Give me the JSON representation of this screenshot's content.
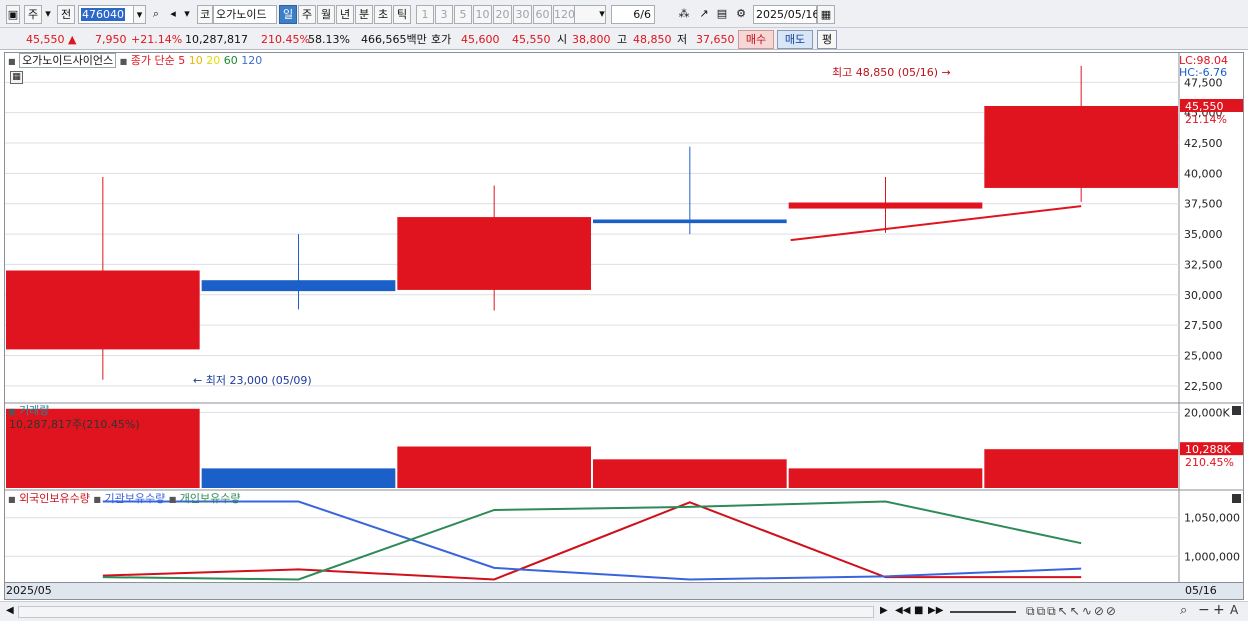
{
  "toolbar": {
    "period_label": "주",
    "prev_label": "전",
    "stock_code": "476040",
    "code_prefix": "코",
    "stock_name": "오가노이드",
    "tabs": [
      "일",
      "주",
      "월",
      "년",
      "분",
      "초",
      "틱"
    ],
    "active_tab": "일",
    "intervals": [
      "1",
      "3",
      "5",
      "10",
      "20",
      "30",
      "60",
      "120"
    ],
    "page_indicator": "6/6",
    "date": "2025/05/16"
  },
  "quote": {
    "price": "45,550",
    "change": "7,950",
    "change_pct": "+21.14%",
    "volume": "10,287,817",
    "volume_ratio": "210.45%",
    "turnover_pct": "58.13%",
    "trade_value": "466,565백만",
    "ask_label": "호가",
    "ask_price": "45,600",
    "bid_price": "45,550",
    "open_label": "시",
    "open": "38,800",
    "high_label": "고",
    "high": "48,850",
    "low_label": "저",
    "low": "37,650",
    "buy_label": "매수",
    "sell_label": "매도",
    "eval_label": "평"
  },
  "price_legend": {
    "name": "오가노이드사이언스",
    "ma_label": "종가 단순",
    "ma_periods": [
      "5",
      "10",
      "20",
      "60",
      "120"
    ],
    "ma_colors": [
      "#e0141e",
      "#f0b400",
      "#e8d800",
      "#1c8a2e",
      "#3c6ed0"
    ]
  },
  "volume_legend": {
    "title": "거래량",
    "value_text": "10,287,817주(210.45%)"
  },
  "holding_legend": [
    "외국인보유수량",
    "기관보유수량",
    "개인보유수량"
  ],
  "right_labels": {
    "lc": "LC:98.04",
    "hc": "HC:-6.76",
    "price_marker": "45,550",
    "price_pct": "21.14%",
    "vol_marker": "10,288K",
    "vol_pct": "210.45%"
  },
  "annotations": {
    "high": "최고 48,850 (05/16)",
    "low": "최저 23,000 (05/09)"
  },
  "date_bar": {
    "left": "2025/05",
    "right": "05/16"
  },
  "colors": {
    "up": "#e0141e",
    "down": "#1b5fc9",
    "ma5": "#e0141e",
    "foreign": "#d0101a",
    "institution": "#3a64dc",
    "individual": "#2e8b57"
  },
  "chart_data": [
    {
      "type": "candlestick",
      "ylim": [
        21250,
        49750
      ],
      "yticks": [
        22500,
        25000,
        27500,
        30000,
        32500,
        35000,
        37500,
        40000,
        42500,
        45000,
        47500
      ],
      "ytick_labels": [
        "22,500",
        "25,000",
        "27,500",
        "30,000",
        "32,500",
        "35,000",
        "37,500",
        "40,000",
        "42,500",
        "45,000",
        "47,500"
      ],
      "candles": [
        {
          "open": 25500,
          "high": 39700,
          "low": 23000,
          "close": 32000
        },
        {
          "open": 31200,
          "high": 35000,
          "low": 28800,
          "close": 30300
        },
        {
          "open": 30400,
          "high": 39000,
          "low": 28700,
          "close": 36400
        },
        {
          "open": 36200,
          "high": 42200,
          "low": 35000,
          "close": 35900
        },
        {
          "open": 37100,
          "high": 39700,
          "low": 35100,
          "close": 37600
        },
        {
          "open": 38800,
          "high": 48850,
          "low": 37650,
          "close": 45550
        }
      ],
      "ma5": [
        null,
        null,
        null,
        null,
        34500,
        37300
      ]
    },
    {
      "type": "bar",
      "title": "거래량",
      "ylim": [
        0,
        22000
      ],
      "yticks": [
        20000
      ],
      "ytick_labels": [
        "20,000K"
      ],
      "values": [
        21000,
        5200,
        11000,
        7600,
        5200,
        10288
      ],
      "directions": [
        "up",
        "down",
        "up",
        "up",
        "up",
        "up"
      ]
    },
    {
      "type": "line",
      "ylim": [
        968000,
        1082000
      ],
      "yticks": [
        1000000,
        1050000
      ],
      "ytick_labels": [
        "1,000,000",
        "1,050,000"
      ],
      "series": [
        {
          "name": "외국인보유수량",
          "values": [
            975000,
            983000,
            970000,
            1070000,
            973000,
            973000
          ]
        },
        {
          "name": "기관보유수량",
          "values": [
            1071000,
            1071000,
            985000,
            970000,
            974000,
            984000
          ]
        },
        {
          "name": "개인보유수량",
          "values": [
            973000,
            970000,
            1060000,
            1064000,
            1071000,
            1017000
          ]
        }
      ]
    }
  ]
}
